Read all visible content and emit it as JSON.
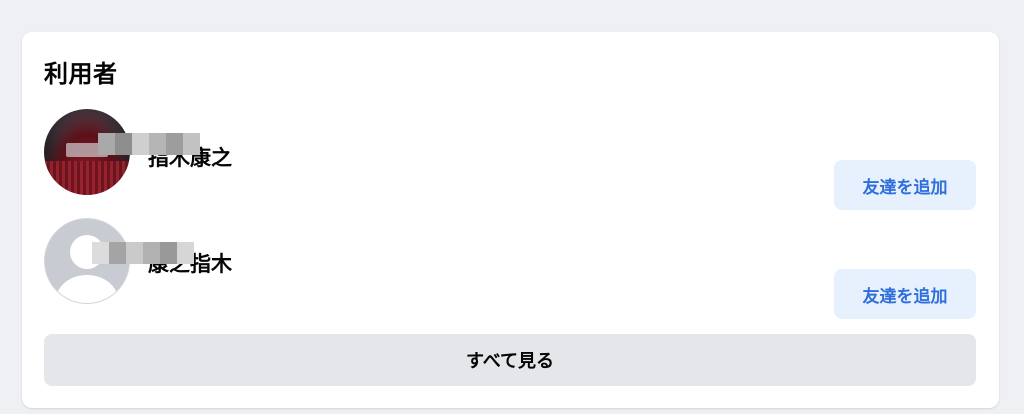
{
  "section": {
    "title": "利用者",
    "see_all_label": "すべて見る"
  },
  "users": [
    {
      "name": "指木康之",
      "avatar": "theater-photo",
      "add_friend_label": "友達を追加"
    },
    {
      "name": "康之指木",
      "avatar": "default-person-icon",
      "add_friend_label": "友達を追加"
    }
  ],
  "colors": {
    "page_background": "#eef0f4",
    "card_background": "#ffffff",
    "add_friend_bg": "#e7f0fd",
    "add_friend_text": "#2f6fdc",
    "see_all_bg": "#e4e6ea"
  }
}
